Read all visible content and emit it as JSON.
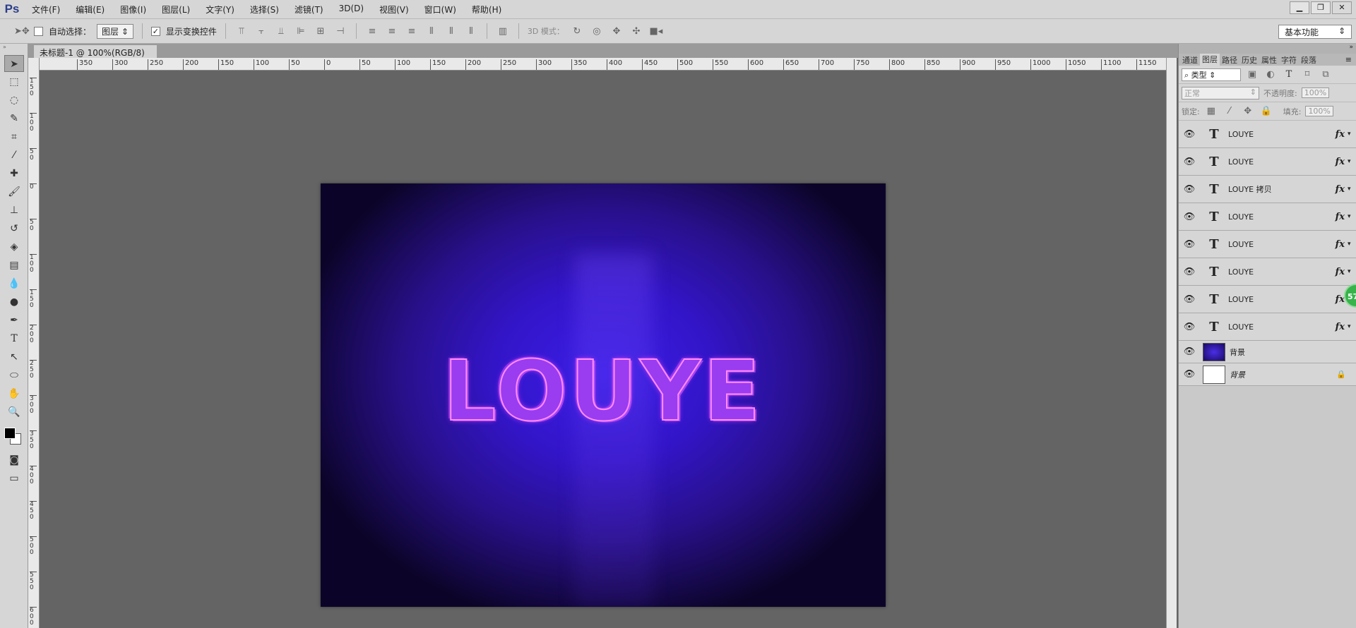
{
  "app": {
    "logo": "Ps"
  },
  "menu": [
    "文件(F)",
    "编辑(E)",
    "图像(I)",
    "图层(L)",
    "文字(Y)",
    "选择(S)",
    "滤镜(T)",
    "3D(D)",
    "视图(V)",
    "窗口(W)",
    "帮助(H)"
  ],
  "window_controls": [
    "▁",
    "❐",
    "✕"
  ],
  "options": {
    "auto_select_label": "自动选择：",
    "auto_select_checked": false,
    "target": "图层",
    "show_transform_label": "显示变换控件",
    "show_transform_checked": true,
    "mode3d_label": "3D 模式：",
    "workspace": "基本功能"
  },
  "document": {
    "tab_title": "未标题-1 @ 100%(RGB/8) *",
    "close": "×",
    "canvas_text": "LOUYE"
  },
  "rulers": {
    "h_labels": [
      "350",
      "300",
      "250",
      "200",
      "150",
      "100",
      "50",
      "0",
      "50",
      "100",
      "150",
      "200",
      "250",
      "300",
      "350",
      "400",
      "450",
      "500",
      "550",
      "600",
      "650",
      "700",
      "750",
      "800",
      "850",
      "900",
      "950",
      "1000",
      "1050",
      "1100",
      "1150"
    ],
    "v_labels": [
      "150",
      "100",
      "50",
      "0",
      "50",
      "100",
      "150",
      "200",
      "250",
      "300",
      "350",
      "400",
      "450",
      "500",
      "550",
      "600"
    ]
  },
  "panel": {
    "tabs": [
      "通道",
      "图层",
      "路径",
      "历史",
      "属性",
      "字符",
      "段落"
    ],
    "active_tab": "图层",
    "filter": "类型",
    "blend_mode": "正常",
    "opacity_label": "不透明度:",
    "opacity": "100%",
    "lock_label": "锁定:",
    "fill_label": "填充:",
    "fill": "100%",
    "layers": [
      {
        "name": "LOUYE",
        "type": "text",
        "fx": true
      },
      {
        "name": "LOUYE",
        "type": "text",
        "fx": true
      },
      {
        "name": "LOUYE 拷贝",
        "type": "text",
        "fx": true
      },
      {
        "name": "LOUYE",
        "type": "text",
        "fx": true
      },
      {
        "name": "LOUYE",
        "type": "text",
        "fx": true
      },
      {
        "name": "LOUYE",
        "type": "text",
        "fx": true
      },
      {
        "name": "LOUYE",
        "type": "text",
        "fx": true
      },
      {
        "name": "LOUYE",
        "type": "text",
        "fx": true
      },
      {
        "name": "背景",
        "type": "image"
      },
      {
        "name": "背景",
        "type": "background",
        "locked": true
      }
    ]
  },
  "badge": "57"
}
